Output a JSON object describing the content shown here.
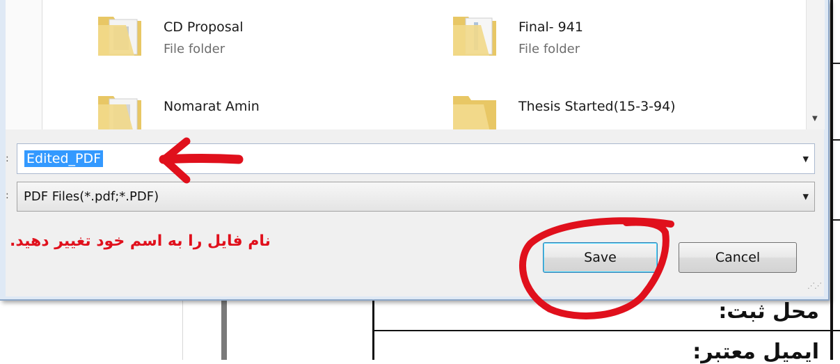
{
  "file_list": {
    "items": [
      {
        "name": "CD Proposal",
        "type": "File folder"
      },
      {
        "name": "Final- 941",
        "type": "File folder"
      },
      {
        "name": "Nomarat Amin",
        "type": ""
      },
      {
        "name": "Thesis Started(15-3-94)",
        "type": ""
      }
    ]
  },
  "save_form": {
    "filename_value": "Edited_PDF",
    "filetype_value": "PDF Files(*.pdf;*.PDF)"
  },
  "buttons": {
    "save_label": "Save",
    "cancel_label": "Cancel"
  },
  "annotation": {
    "text": "نام فایل را به اسم خود تغییر دهید.",
    "color": "#e0101c"
  },
  "background_document": {
    "line1": "محل ثبت:",
    "line2": "ایمیل معتبر:"
  },
  "colors": {
    "selection": "#3399ff",
    "dialog_frame": "#dfe9f5",
    "dialog_body": "#f0f0f0"
  },
  "icons": {
    "folder": "folder-icon",
    "dropdown": "chevron-down-icon",
    "scroll": "scroll-down-arrow-icon"
  }
}
